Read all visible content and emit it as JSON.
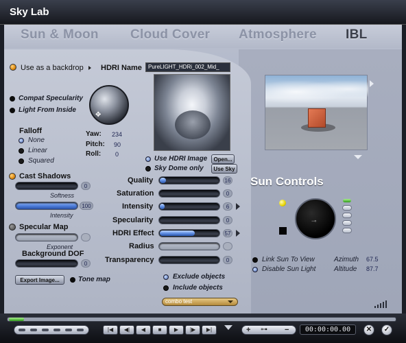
{
  "window": {
    "title": "Sky Lab"
  },
  "tabs": [
    {
      "label": "Sun & Moon",
      "active": false
    },
    {
      "label": "Cloud Cover",
      "active": false
    },
    {
      "label": "Atmosphere",
      "active": false
    },
    {
      "label": "IBL",
      "active": true
    }
  ],
  "ibl": {
    "use_as_backdrop": "Use as a backdrop",
    "hdri_name_label": "HDRI Name",
    "hdri_name_value": "PureLIGHT_HDRi_002_Mid_",
    "compat_specularity": "Compat Specularity",
    "light_from_inside": "Light From Inside",
    "falloff_label": "Falloff",
    "falloff_options": [
      "None",
      "Linear",
      "Squared"
    ],
    "falloff_selected": "None",
    "yaw_label": "Yaw:",
    "yaw_value": "234",
    "pitch_label": "Pitch:",
    "pitch_value": "90",
    "roll_label": "Roll:",
    "roll_value": "0",
    "use_hdri_image": "Use HDRI Image",
    "sky_dome_only": "Sky Dome only",
    "open_button": "Open...",
    "use_sky_button": "Use Sky",
    "cast_shadows": "Cast Shadows",
    "softness_label": "Softness",
    "softness_value": "0",
    "intensity_label": "Intensity",
    "intensity_value": "100",
    "specular_map": "Specular Map",
    "exponent_label": "Exponent",
    "background_dof": "Background DOF",
    "background_dof_value": "0",
    "export_image_button": "Export Image...",
    "tone_map": "Tone map",
    "quality_label": "Quality",
    "quality_value": "16",
    "saturation_label": "Saturation",
    "saturation_value": "0",
    "intensity2_label": "Intensity",
    "intensity2_value": "6",
    "specularity_label": "Specularity",
    "specularity_value": "0",
    "hdri_effect_label": "HDRI Effect",
    "hdri_effect_value": "57",
    "radius_label": "Radius",
    "transparency_label": "Transparency",
    "transparency_value": "0",
    "exclude_objects": "Exclude objects",
    "include_objects": "Include objects",
    "combo_value": "combo test"
  },
  "sun_controls": {
    "title": "Sun Controls",
    "link_sun_to_view": "Link Sun To View",
    "disable_sun_light": "Disable Sun Light",
    "azimuth_label": "Azimuth",
    "azimuth_value": "67.5",
    "altitude_label": "Altitude",
    "altitude_value": "87.7"
  },
  "bottom": {
    "timecode": "00:00:00.00"
  },
  "colors": {
    "accent_orange": "#e08a10",
    "slider_blue": "#4f7fdc",
    "value_text": "#1d2450",
    "panel": "#b7bdcc"
  }
}
